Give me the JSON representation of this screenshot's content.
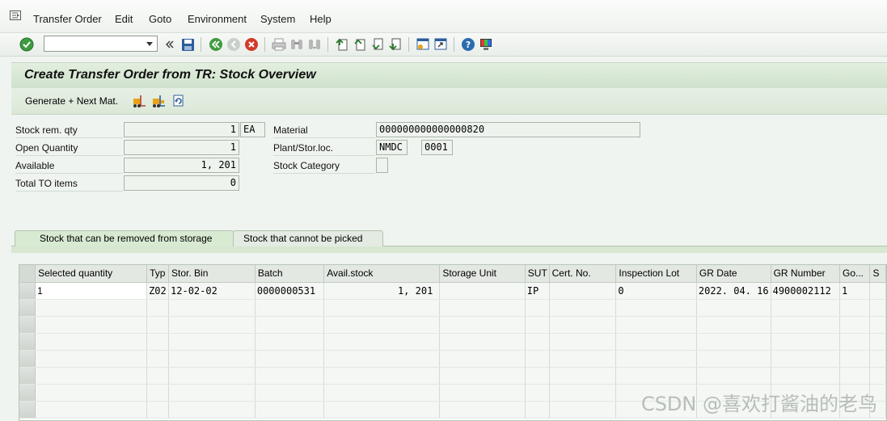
{
  "menu": {
    "items": [
      "Transfer Order",
      "Edit",
      "Goto",
      "Environment",
      "System",
      "Help"
    ]
  },
  "toolbar": {
    "command_field_value": "",
    "icons": [
      "enter-icon",
      "back-double-arrow-icon",
      "save-icon",
      "back-icon",
      "exit-icon",
      "cancel-icon",
      "print-icon",
      "find-icon",
      "find-next-icon",
      "first-page-icon",
      "previous-page-icon",
      "next-page-icon",
      "last-page-icon",
      "create-session-icon",
      "generate-shortcut-icon",
      "help-icon",
      "customize-layout-icon"
    ]
  },
  "screen": {
    "title": "Create Transfer Order from TR: Stock Overview",
    "app_toolbar": {
      "generate_next_label": "Generate + Next Mat."
    }
  },
  "header": {
    "stock_rem_qty": {
      "label": "Stock rem. qty",
      "value": "1",
      "unit": "EA"
    },
    "open_quantity": {
      "label": "Open Quantity",
      "value": "1"
    },
    "available": {
      "label": "Available",
      "value": "1, 201"
    },
    "total_to_items": {
      "label": "Total TO items",
      "value": "0"
    },
    "material": {
      "label": "Material",
      "value": "000000000000000820"
    },
    "plant_stor_loc": {
      "label": "Plant/Stor.loc.",
      "plant": "NMDC",
      "stor_loc": "0001"
    },
    "stock_category": {
      "label": "Stock Category",
      "value": ""
    }
  },
  "tabs": [
    {
      "label": "Stock that can be removed from storage",
      "active": true
    },
    {
      "label": "Stock that cannot be picked",
      "active": false
    }
  ],
  "grid": {
    "columns": [
      "Selected quantity",
      "Typ",
      "Stor. Bin",
      "Batch",
      "Avail.stock",
      "Storage Unit",
      "SUT",
      "Cert. No.",
      "Inspection Lot",
      "GR Date",
      "GR Number",
      "Go...",
      "S"
    ],
    "rows": [
      [
        "1",
        "Z02",
        "12-02-02",
        "0000000531",
        "1, 201",
        "",
        "IP",
        "",
        "0",
        "2022. 04. 16",
        "4900002112",
        "1",
        ""
      ]
    ]
  },
  "watermark": "CSDN @喜欢打酱油的老鸟",
  "colors": {
    "background": "#f0f4f0",
    "title_bar": "#d4e6d0",
    "enter_green": "#3f9b3f",
    "exit_red": "#d23a2a",
    "help_blue": "#2b6cb0"
  }
}
